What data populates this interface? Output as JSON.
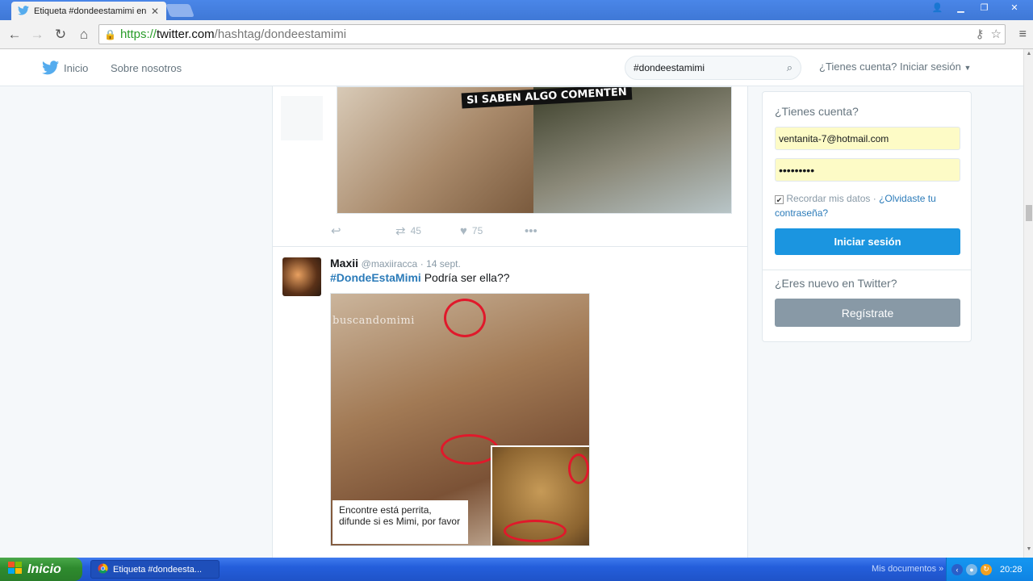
{
  "browser": {
    "tab_title": "Etiqueta #dondeestamimi en",
    "url_scheme": "https://",
    "url_host": "twitter.com",
    "url_path": "/hashtag/dondeestamimi",
    "icons": [
      "back-icon",
      "forward-icon",
      "reload-icon",
      "home-icon",
      "lock-icon",
      "key-icon",
      "star-icon",
      "menu-icon"
    ]
  },
  "nav": {
    "home": "Inicio",
    "about": "Sobre nosotros",
    "search_value": "#dondeestamimi",
    "login_link": "¿Tienes cuenta? Iniciar sesión"
  },
  "tweet1": {
    "meme_caption": "SI SABEN ALGO COMENTEN",
    "retweets": "45",
    "likes": "75"
  },
  "tweet2": {
    "name": "Maxii",
    "handle": "@maxiiracca",
    "time": "· 14 sept.",
    "hashtag": "#DondeEstaMimi",
    "text": "Podría ser ella??",
    "watermark": "buscandomimi",
    "caption": "Encontre está perrita, difunde si es Mimi, por favor"
  },
  "login_card": {
    "title": "¿Tienes cuenta?",
    "email": "ventanita-7@hotmail.com",
    "password": "•••••••••",
    "remember": "Recordar mis datos ·",
    "forgot": "¿Olvidaste tu contraseña?",
    "login_button": "Iniciar sesión",
    "new_prompt": "¿Eres nuevo en Twitter?",
    "signup_button": "Regístrate"
  },
  "taskbar": {
    "start": "Inicio",
    "task": "Etiqueta #dondeesta...",
    "tray_label": "Mis documentos",
    "clock": "20:28"
  },
  "colors": {
    "twitter_blue": "#1b95e0",
    "link": "#2b7bb9",
    "autofill": "#fdfbc6"
  }
}
